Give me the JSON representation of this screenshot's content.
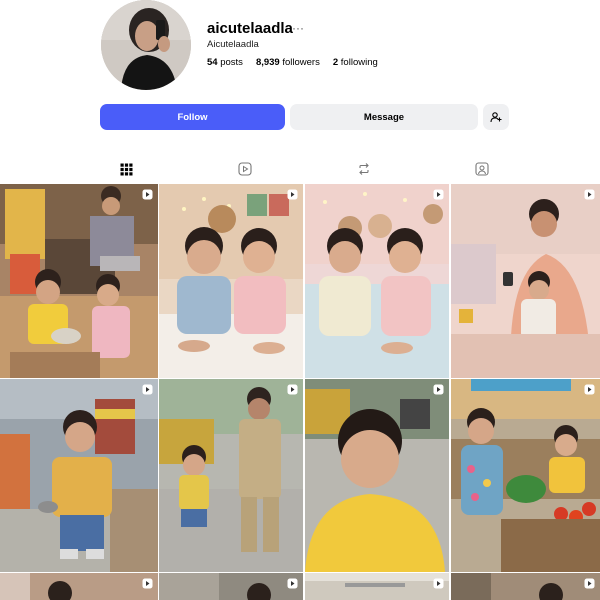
{
  "profile": {
    "username": "aicutelaadla",
    "more": "···",
    "full_name": "Aicutelaadla",
    "stats": {
      "posts": "54",
      "posts_label": "posts",
      "followers": "8,939",
      "followers_label": "followers",
      "following": "2",
      "following_label": "following"
    }
  },
  "actions": {
    "follow_label": "Follow",
    "message_label": "Message",
    "add_user_icon": "add-user-icon"
  },
  "tabs": [
    {
      "name": "posts",
      "icon": "grid-icon",
      "active": true
    },
    {
      "name": "reels",
      "icon": "reels-icon",
      "active": false
    },
    {
      "name": "reposts",
      "icon": "repost-icon",
      "active": false
    },
    {
      "name": "tagged",
      "icon": "tagged-icon",
      "active": false
    }
  ],
  "colors": {
    "accent": "#4a5df9",
    "secondary_button": "#eff0f2"
  },
  "grid": {
    "tiles": [
      {
        "subject": "kitchen-kids-with-father",
        "reel": true
      },
      {
        "subject": "baby-twins-on-bed",
        "reel": true
      },
      {
        "subject": "baby-twins-on-bed-2",
        "reel": true
      },
      {
        "subject": "mother-with-baby-phone",
        "reel": true
      },
      {
        "subject": "toddler-railway-station",
        "reel": true
      },
      {
        "subject": "toddler-with-police",
        "reel": true
      },
      {
        "subject": "toddler-street",
        "reel": true
      },
      {
        "subject": "kids-vegetable-market",
        "reel": true
      },
      {
        "subject": "partial-row",
        "reel": true
      },
      {
        "subject": "partial-row",
        "reel": true
      },
      {
        "subject": "partial-row",
        "reel": true
      },
      {
        "subject": "partial-row",
        "reel": true
      }
    ]
  }
}
